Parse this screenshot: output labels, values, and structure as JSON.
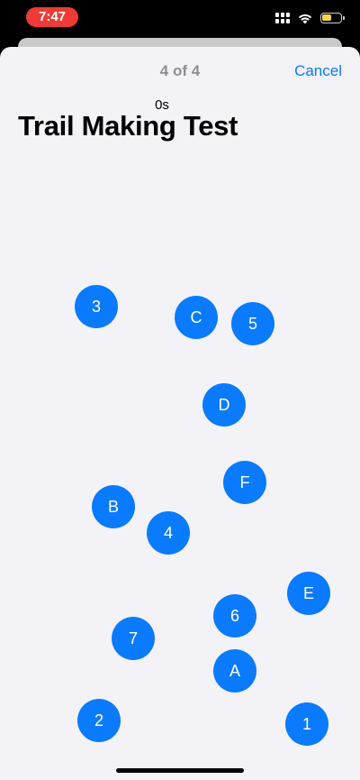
{
  "status_bar": {
    "time": "7:47",
    "icons": [
      "cellular-icon",
      "wifi-icon",
      "battery-charging-icon"
    ],
    "battery_color": "#f7d54a"
  },
  "header": {
    "progress": "4 of 4",
    "cancel_label": "Cancel"
  },
  "test": {
    "timer": "0s",
    "title": "Trail Making Test",
    "accent_color": "#0a7aff",
    "nodes": [
      {
        "label": "3"
      },
      {
        "label": "C"
      },
      {
        "label": "5"
      },
      {
        "label": "D"
      },
      {
        "label": "F"
      },
      {
        "label": "B"
      },
      {
        "label": "4"
      },
      {
        "label": "E"
      },
      {
        "label": "6"
      },
      {
        "label": "7"
      },
      {
        "label": "A"
      },
      {
        "label": "2"
      },
      {
        "label": "1"
      }
    ]
  }
}
